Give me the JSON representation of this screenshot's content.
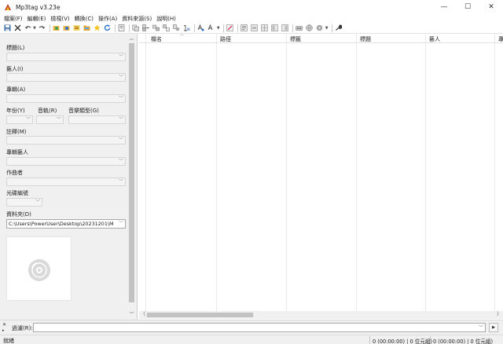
{
  "window": {
    "title": "Mp3tag v3.23e",
    "controls": {
      "minimize": "—",
      "maximize": "☐",
      "close": "✕"
    }
  },
  "menu": [
    "檔案(F)",
    "編輯(E)",
    "檢視(V)",
    "轉換(C)",
    "操作(A)",
    "資料來源(S)",
    "說明(H)"
  ],
  "toolbar": {
    "icons": [
      "save-icon",
      "remove-tag-icon",
      "undo-icon",
      "redo-icon",
      "change-dir-icon",
      "add-dir-icon",
      "playlist-icon",
      "folder-icon",
      "favorite-star-icon",
      "refresh-icon",
      "options-icon",
      "tag-to-filename-icon",
      "filename-to-tag-icon",
      "text-file-icon",
      "case-conversion-icon",
      "export-icon",
      "actions-icon",
      "web-source-icon",
      "settings-wrench-icon"
    ]
  },
  "tag_panel": {
    "title_label": "標題(L)",
    "artist_label": "藝人(I)",
    "album_label": "專輯(A)",
    "year_label": "年份(Y)",
    "track_label": "音軌(R)",
    "genre_label": "音樂類型(G)",
    "comment_label": "註釋(M)",
    "album_artist_label": "專輯藝人",
    "composer_label": "作曲者",
    "disc_label": "光碟編號",
    "directory_label": "資料夾(D)",
    "directory_value": "C:\\Users\\PowerUser\\Desktop\\20231201\\M"
  },
  "file_list": {
    "columns": [
      "檔名",
      "路徑",
      "標籤",
      "標題",
      "藝人",
      "專"
    ]
  },
  "filter": {
    "label": "過濾(R):",
    "value": ""
  },
  "status": {
    "left": "就緒",
    "selected": "0 (00:00:00) | 0 位元組)",
    "total": "0 (00:00:00) | 0 位元組)"
  }
}
